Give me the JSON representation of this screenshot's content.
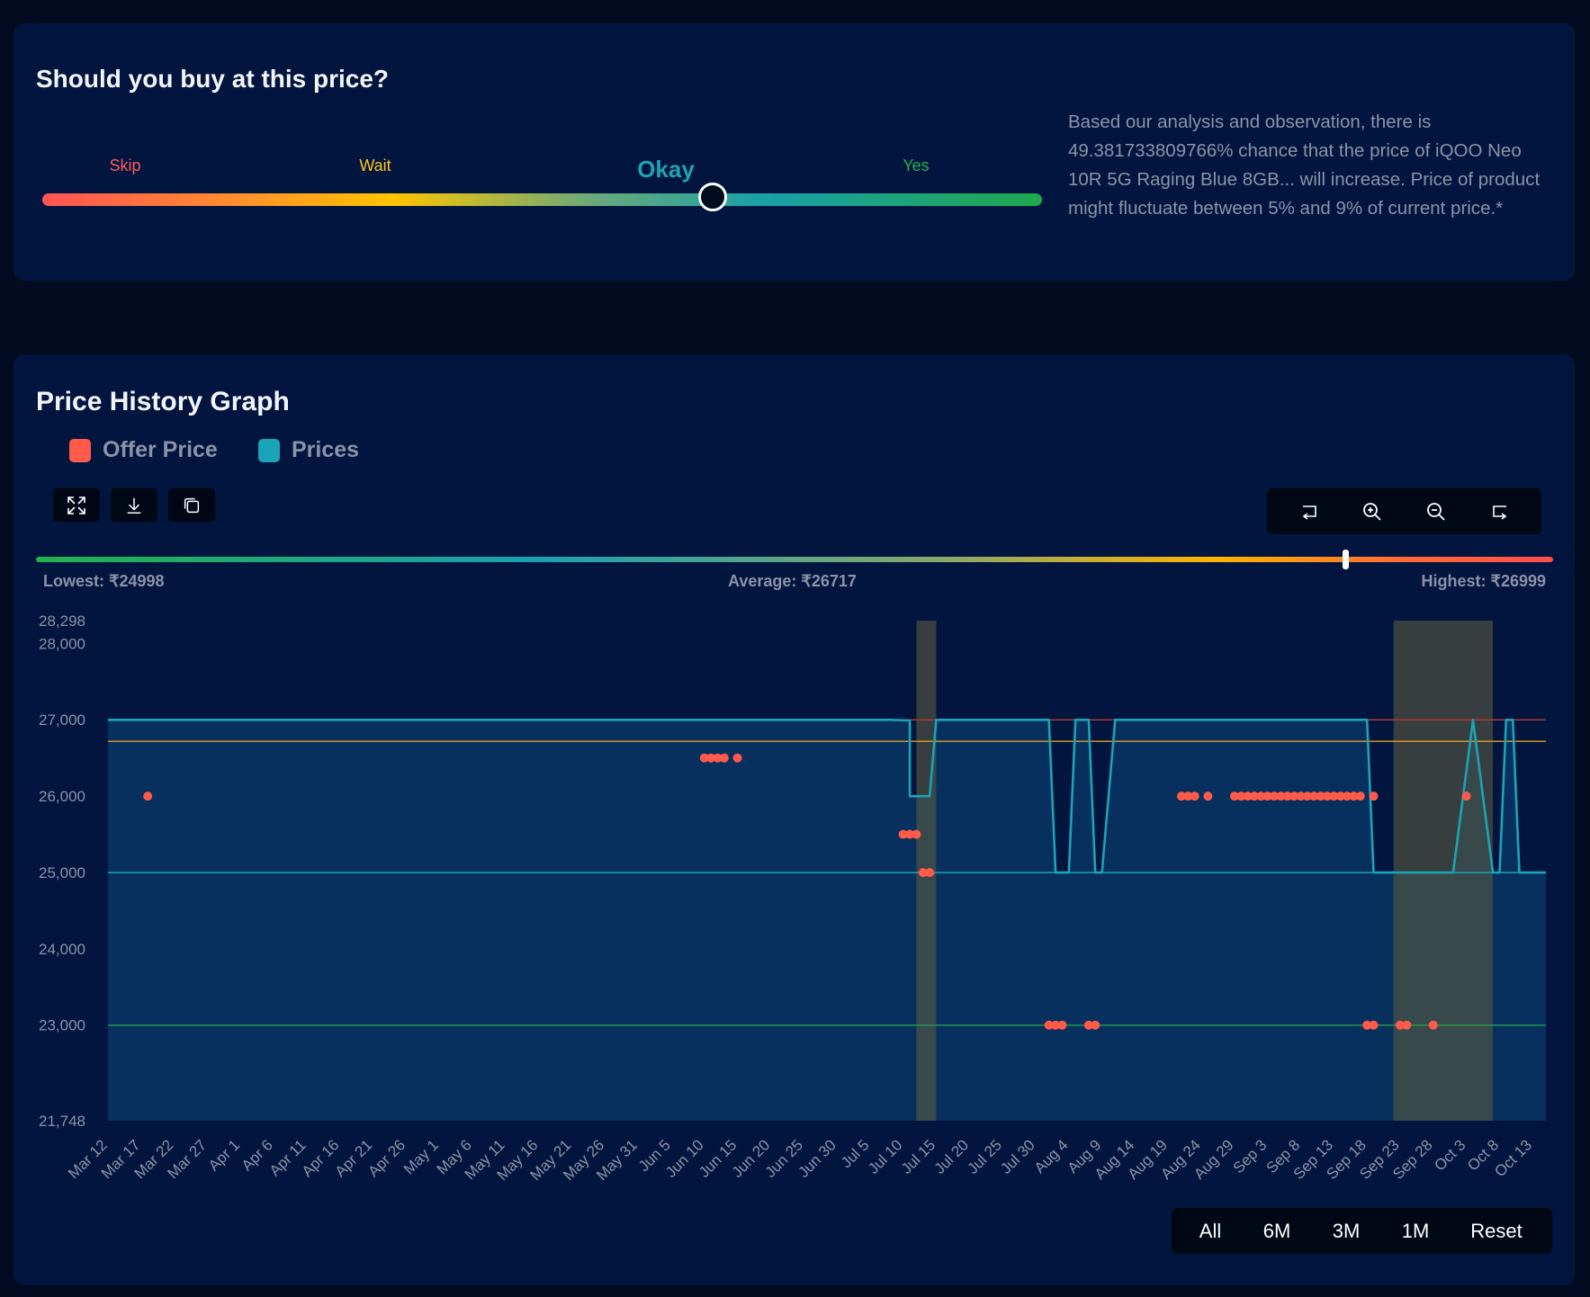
{
  "verdict": {
    "title": "Should you buy at this price?",
    "labels": [
      {
        "text": "Skip",
        "color": "#ff5a5a"
      },
      {
        "text": "Wait",
        "color": "#ffc21a"
      },
      {
        "text": "Okay",
        "color": "#1ea3b3"
      },
      {
        "text": "Yes",
        "color": "#25b04f"
      }
    ],
    "selected": "Okay",
    "description": "Based our analysis and observation, there is 49.381733809766% chance that the price of iQOO Neo 10R 5G Raging Blue 8GB... will increase. Price of product might fluctuate between 5% and 9% of current price.*"
  },
  "graph": {
    "title": "Price History Graph",
    "toolbar_icons": [
      "expand-icon",
      "download-icon",
      "copy-icon"
    ],
    "zoom_icons": [
      "pan-left-icon",
      "zoom-in-icon",
      "zoom-out-icon",
      "pan-right-icon"
    ],
    "range": {
      "lowest": "Lowest: ₹24998",
      "average": "Average: ₹26717",
      "highest": "Highest: ₹26999",
      "current_position_pct": 86.3
    },
    "periods": [
      "All",
      "6M",
      "3M",
      "1M",
      "Reset"
    ]
  },
  "chart_data": {
    "type": "line",
    "legend": [
      {
        "name": "Offer Price",
        "color": "#ff5a4a"
      },
      {
        "name": "Prices",
        "color": "#1aa4b8"
      }
    ],
    "ylim": [
      21748,
      28298
    ],
    "y_ticks": [
      21748,
      23000,
      24000,
      25000,
      26000,
      27000,
      28000,
      28298
    ],
    "y_tick_labels": [
      "21,748",
      "23,000",
      "24,000",
      "25,000",
      "26,000",
      "27,000",
      "28,000",
      "28,298"
    ],
    "x_range": [
      "2025-03-12",
      "2025-10-15"
    ],
    "x_ticks": [
      "2025-03-12",
      "2025-03-17",
      "2025-03-22",
      "2025-03-27",
      "2025-04-01",
      "2025-04-06",
      "2025-04-11",
      "2025-04-16",
      "2025-04-21",
      "2025-04-26",
      "2025-05-01",
      "2025-05-06",
      "2025-05-11",
      "2025-05-16",
      "2025-05-21",
      "2025-05-26",
      "2025-05-31",
      "2025-06-05",
      "2025-06-10",
      "2025-06-15",
      "2025-06-20",
      "2025-06-25",
      "2025-06-30",
      "2025-07-05",
      "2025-07-10",
      "2025-07-15",
      "2025-07-20",
      "2025-07-25",
      "2025-07-30",
      "2025-08-04",
      "2025-08-09",
      "2025-08-14",
      "2025-08-19",
      "2025-08-24",
      "2025-08-29",
      "2025-09-03",
      "2025-09-08",
      "2025-09-13",
      "2025-09-18",
      "2025-09-23",
      "2025-09-28",
      "2025-10-03",
      "2025-10-08",
      "2025-10-13"
    ],
    "x_tick_labels": [
      "Mar 12",
      "Mar 17",
      "Mar 22",
      "Mar 27",
      "Apr 1",
      "Apr 6",
      "Apr 11",
      "Apr 16",
      "Apr 21",
      "Apr 26",
      "May 1",
      "May 6",
      "May 11",
      "May 16",
      "May 21",
      "May 26",
      "May 31",
      "Jun 5",
      "Jun 10",
      "Jun 15",
      "Jun 20",
      "Jun 25",
      "Jun 30",
      "Jul 5",
      "Jul 10",
      "Jul 15",
      "Jul 20",
      "Jul 25",
      "Jul 30",
      "Aug 4",
      "Aug 9",
      "Aug 14",
      "Aug 19",
      "Aug 24",
      "Aug 29",
      "Sep 3",
      "Sep 8",
      "Sep 13",
      "Sep 18",
      "Sep 23",
      "Sep 28",
      "Oct 3",
      "Oct 8",
      "Oct 13"
    ],
    "reference_lines": [
      {
        "value": 26999,
        "color": "#c0392b"
      },
      {
        "value": 26717,
        "color": "#e0a020"
      },
      {
        "value": 24998,
        "color": "#1aa4b8"
      },
      {
        "value": 22999,
        "color": "#22a04a"
      }
    ],
    "highlight_bands": [
      {
        "from": "2025-07-12",
        "to": "2025-07-15"
      },
      {
        "from": "2025-09-22",
        "to": "2025-10-07"
      }
    ],
    "series": [
      {
        "name": "Prices",
        "color": "#1aa4b8",
        "points": [
          [
            "2025-03-12",
            26999
          ],
          [
            "2025-07-08",
            26999
          ],
          [
            "2025-07-11",
            26990
          ],
          [
            "2025-07-11",
            25999
          ],
          [
            "2025-07-14",
            25999
          ],
          [
            "2025-07-15",
            26999
          ],
          [
            "2025-08-01",
            26999
          ],
          [
            "2025-08-02",
            24998
          ],
          [
            "2025-08-04",
            24998
          ],
          [
            "2025-08-05",
            26999
          ],
          [
            "2025-08-07",
            26999
          ],
          [
            "2025-08-08",
            24998
          ],
          [
            "2025-08-09",
            24998
          ],
          [
            "2025-08-11",
            26999
          ],
          [
            "2025-09-18",
            26999
          ],
          [
            "2025-09-19",
            24998
          ],
          [
            "2025-10-01",
            24998
          ],
          [
            "2025-10-04",
            26999
          ],
          [
            "2025-10-07",
            24998
          ],
          [
            "2025-10-08",
            24998
          ],
          [
            "2025-10-09",
            26999
          ],
          [
            "2025-10-10",
            26999
          ],
          [
            "2025-10-11",
            24998
          ],
          [
            "2025-10-15",
            24998
          ]
        ]
      },
      {
        "name": "Offer Price",
        "color": "#ff5a4a",
        "points": [
          [
            "2025-03-18",
            25999
          ],
          [
            "2025-06-10",
            26499
          ],
          [
            "2025-06-11",
            26499
          ],
          [
            "2025-06-12",
            26499
          ],
          [
            "2025-06-13",
            26499
          ],
          [
            "2025-06-15",
            26499
          ],
          [
            "2025-07-10",
            25499
          ],
          [
            "2025-07-11",
            25499
          ],
          [
            "2025-07-12",
            25499
          ],
          [
            "2025-07-13",
            24998
          ],
          [
            "2025-07-14",
            24998
          ],
          [
            "2025-08-01",
            22999
          ],
          [
            "2025-08-02",
            22999
          ],
          [
            "2025-08-03",
            22999
          ],
          [
            "2025-08-07",
            22999
          ],
          [
            "2025-08-08",
            22999
          ],
          [
            "2025-08-21",
            25999
          ],
          [
            "2025-08-22",
            25999
          ],
          [
            "2025-08-23",
            25999
          ],
          [
            "2025-08-25",
            25999
          ],
          [
            "2025-08-29",
            25999
          ],
          [
            "2025-08-30",
            25999
          ],
          [
            "2025-08-31",
            25999
          ],
          [
            "2025-09-01",
            25999
          ],
          [
            "2025-09-02",
            25999
          ],
          [
            "2025-09-03",
            25999
          ],
          [
            "2025-09-04",
            25999
          ],
          [
            "2025-09-05",
            25999
          ],
          [
            "2025-09-06",
            25999
          ],
          [
            "2025-09-07",
            25999
          ],
          [
            "2025-09-08",
            25999
          ],
          [
            "2025-09-09",
            25999
          ],
          [
            "2025-09-10",
            25999
          ],
          [
            "2025-09-11",
            25999
          ],
          [
            "2025-09-12",
            25999
          ],
          [
            "2025-09-13",
            25999
          ],
          [
            "2025-09-14",
            25999
          ],
          [
            "2025-09-15",
            25999
          ],
          [
            "2025-09-16",
            25999
          ],
          [
            "2025-09-17",
            25999
          ],
          [
            "2025-09-19",
            25999
          ],
          [
            "2025-09-18",
            22999
          ],
          [
            "2025-09-19",
            22999
          ],
          [
            "2025-09-23",
            22999
          ],
          [
            "2025-09-24",
            22999
          ],
          [
            "2025-09-28",
            22999
          ],
          [
            "2025-10-03",
            25999
          ]
        ]
      }
    ]
  }
}
